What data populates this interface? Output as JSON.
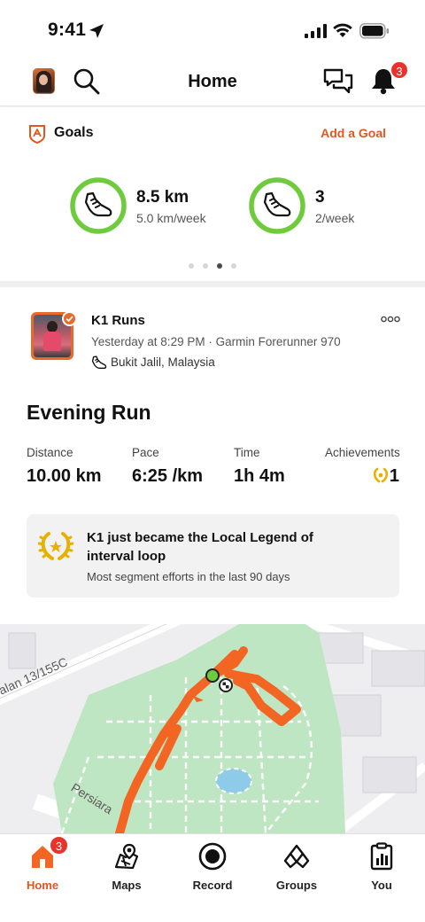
{
  "status_bar": {
    "time": "9:41"
  },
  "header": {
    "title": "Home",
    "notifications_count": "3"
  },
  "goals": {
    "title": "Goals",
    "add_label": "Add a Goal",
    "items": [
      {
        "value": "8.5 km",
        "target": "5.0 km/week",
        "progress": 1.0
      },
      {
        "value": "3",
        "target": "2/week",
        "progress": 1.0
      }
    ],
    "pages": 4,
    "active_page": 3
  },
  "activity": {
    "athlete": "K1 Runs",
    "meta": "Yesterday at 8:29 PM · Garmin Forerunner 970",
    "location": "Bukit Jalil, Malaysia",
    "title": "Evening Run",
    "stats": [
      {
        "label": "Distance",
        "value": "10.00 km"
      },
      {
        "label": "Pace",
        "value": "6:25 /km"
      },
      {
        "label": "Time",
        "value": "1h 4m"
      },
      {
        "label": "Achievements",
        "value": "1"
      }
    ],
    "legend": {
      "title": "K1 just became the Local Legend of interval loop",
      "subtitle": "Most segment efforts in the last 90 days"
    }
  },
  "map": {
    "street_1": "alan 13/155C",
    "street_2": "Persiara"
  },
  "tabbar": {
    "items": [
      {
        "label": "Home",
        "icon": "home-icon"
      },
      {
        "label": "Maps",
        "icon": "map-icon"
      },
      {
        "label": "Record",
        "icon": "record-icon"
      },
      {
        "label": "Groups",
        "icon": "groups-icon"
      },
      {
        "label": "You",
        "icon": "you-icon"
      }
    ],
    "home_badge": "3"
  },
  "colors": {
    "accent": "#e2571c",
    "goal_ring": "#6ecb3c",
    "route": "#f26522",
    "park": "#bfe6c2",
    "badge": "#e8322a"
  }
}
